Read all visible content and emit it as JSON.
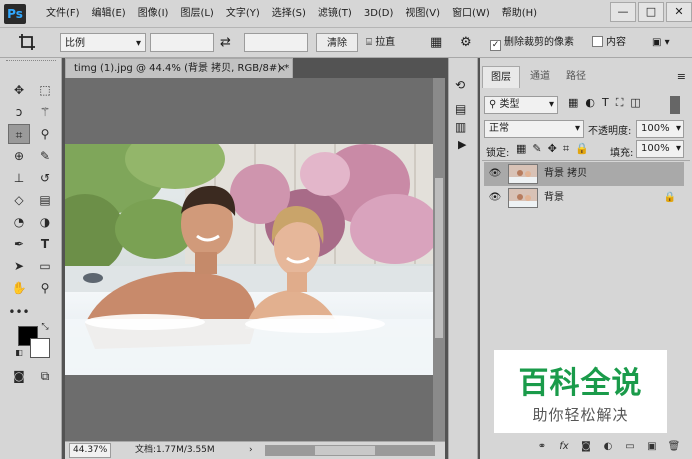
{
  "app": {
    "logo": "Ps"
  },
  "menu": [
    "文件(F)",
    "编辑(E)",
    "图像(I)",
    "图层(L)",
    "文字(Y)",
    "选择(S)",
    "滤镜(T)",
    "3D(D)",
    "视图(V)",
    "窗口(W)",
    "帮助(H)"
  ],
  "window_controls": {
    "minimize": "—",
    "restore": "□",
    "close": "✕"
  },
  "options": {
    "crop_icon": "crop-icon",
    "ratio_value": "比例",
    "swap_icon": "⇄",
    "clear_label": "清除",
    "straighten_label": "拉直",
    "delete_cropped_label": "删除裁剪的像素",
    "content_aware_label": "内容"
  },
  "document": {
    "tab_title": "timg (1).jpg @ 44.4% (背景 拷贝, RGB/8#) *",
    "tab_close": "×"
  },
  "status": {
    "zoom": "44.37%",
    "doc_info": "文档:1.77M/3.55M"
  },
  "layers_panel": {
    "tabs": [
      "图层",
      "通道",
      "路径"
    ],
    "kind_filter": "类型",
    "blend_mode": "正常",
    "opacity_label": "不透明度:",
    "opacity_value": "100%",
    "lock_label": "锁定:",
    "fill_label": "填充:",
    "fill_value": "100%",
    "layers": [
      {
        "name": "背景 拷贝"
      },
      {
        "name": "背景"
      }
    ]
  },
  "watermark": {
    "title": "百科全说",
    "subtitle": "助你轻松解决"
  }
}
